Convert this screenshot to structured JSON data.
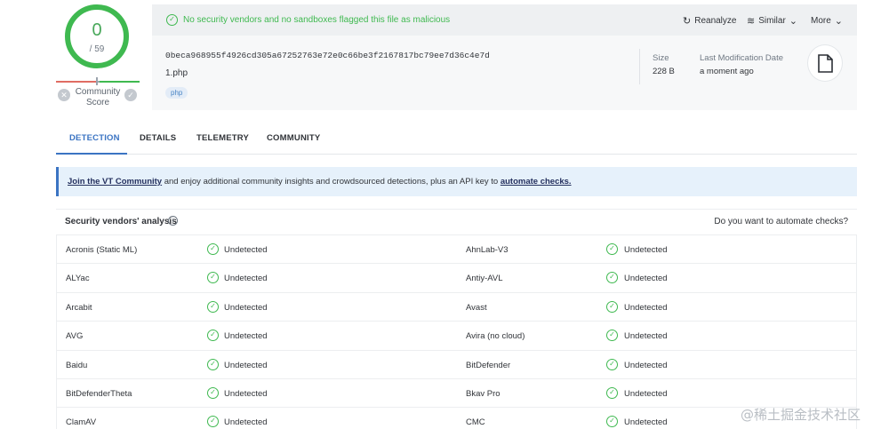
{
  "score": {
    "detections": "0",
    "total": "/ 59",
    "community_label": "Community Score",
    "ring_color": "#3fb950"
  },
  "file": {
    "status": "No security vendors and no sandboxes flagged this file as malicious",
    "actions": {
      "reanalyze": "Reanalyze",
      "similar": "Similar",
      "more": "More"
    },
    "hash": "0beca968955f4926cd305a67252763e72e0c66be3f2167817bc79ee7d36c4e7d",
    "name": "1.php",
    "tag": "php",
    "size_label": "Size",
    "size_value": "228 B",
    "modified_label": "Last Modification Date",
    "modified_value": "a moment ago",
    "file_icon": "file-icon"
  },
  "tabs": [
    "DETECTION",
    "DETAILS",
    "TELEMETRY",
    "COMMUNITY"
  ],
  "banner": {
    "link1": "Join the VT Community",
    "middle": " and enjoy additional community insights and crowdsourced detections, plus an API key to ",
    "link2": "automate checks."
  },
  "table": {
    "heading": "Security vendors' analysis",
    "automate_prompt": "Do you want to automate checks?",
    "rows": [
      {
        "left_vendor": "Acronis (Static ML)",
        "left_result": "Undetected",
        "right_vendor": "AhnLab-V3",
        "right_result": "Undetected"
      },
      {
        "left_vendor": "ALYac",
        "left_result": "Undetected",
        "right_vendor": "Antiy-AVL",
        "right_result": "Undetected"
      },
      {
        "left_vendor": "Arcabit",
        "left_result": "Undetected",
        "right_vendor": "Avast",
        "right_result": "Undetected"
      },
      {
        "left_vendor": "AVG",
        "left_result": "Undetected",
        "right_vendor": "Avira (no cloud)",
        "right_result": "Undetected"
      },
      {
        "left_vendor": "Baidu",
        "left_result": "Undetected",
        "right_vendor": "BitDefender",
        "right_result": "Undetected"
      },
      {
        "left_vendor": "BitDefenderTheta",
        "left_result": "Undetected",
        "right_vendor": "Bkav Pro",
        "right_result": "Undetected"
      },
      {
        "left_vendor": "ClamAV",
        "left_result": "Undetected",
        "right_vendor": "CMC",
        "right_result": "Undetected"
      }
    ]
  },
  "watermark": "@稀土掘金技术社区"
}
